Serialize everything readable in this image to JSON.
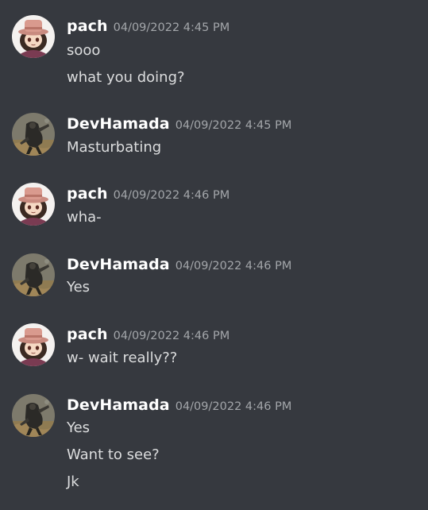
{
  "messages": [
    {
      "author": "pach",
      "timestamp": "04/09/2022 4:45 PM",
      "lines": [
        "sooo",
        "what you doing?"
      ]
    },
    {
      "author": "DevHamada",
      "timestamp": "04/09/2022 4:45 PM",
      "lines": [
        "Masturbating"
      ]
    },
    {
      "author": "pach",
      "timestamp": "04/09/2022 4:46 PM",
      "lines": [
        "wha-"
      ]
    },
    {
      "author": "DevHamada",
      "timestamp": "04/09/2022 4:46 PM",
      "lines": [
        "Yes"
      ]
    },
    {
      "author": "pach",
      "timestamp": "04/09/2022 4:46 PM",
      "lines": [
        "w- wait really??"
      ]
    },
    {
      "author": "DevHamada",
      "timestamp": "04/09/2022 4:46 PM",
      "lines": [
        "Yes",
        "Want to see?",
        "Jk"
      ]
    }
  ]
}
